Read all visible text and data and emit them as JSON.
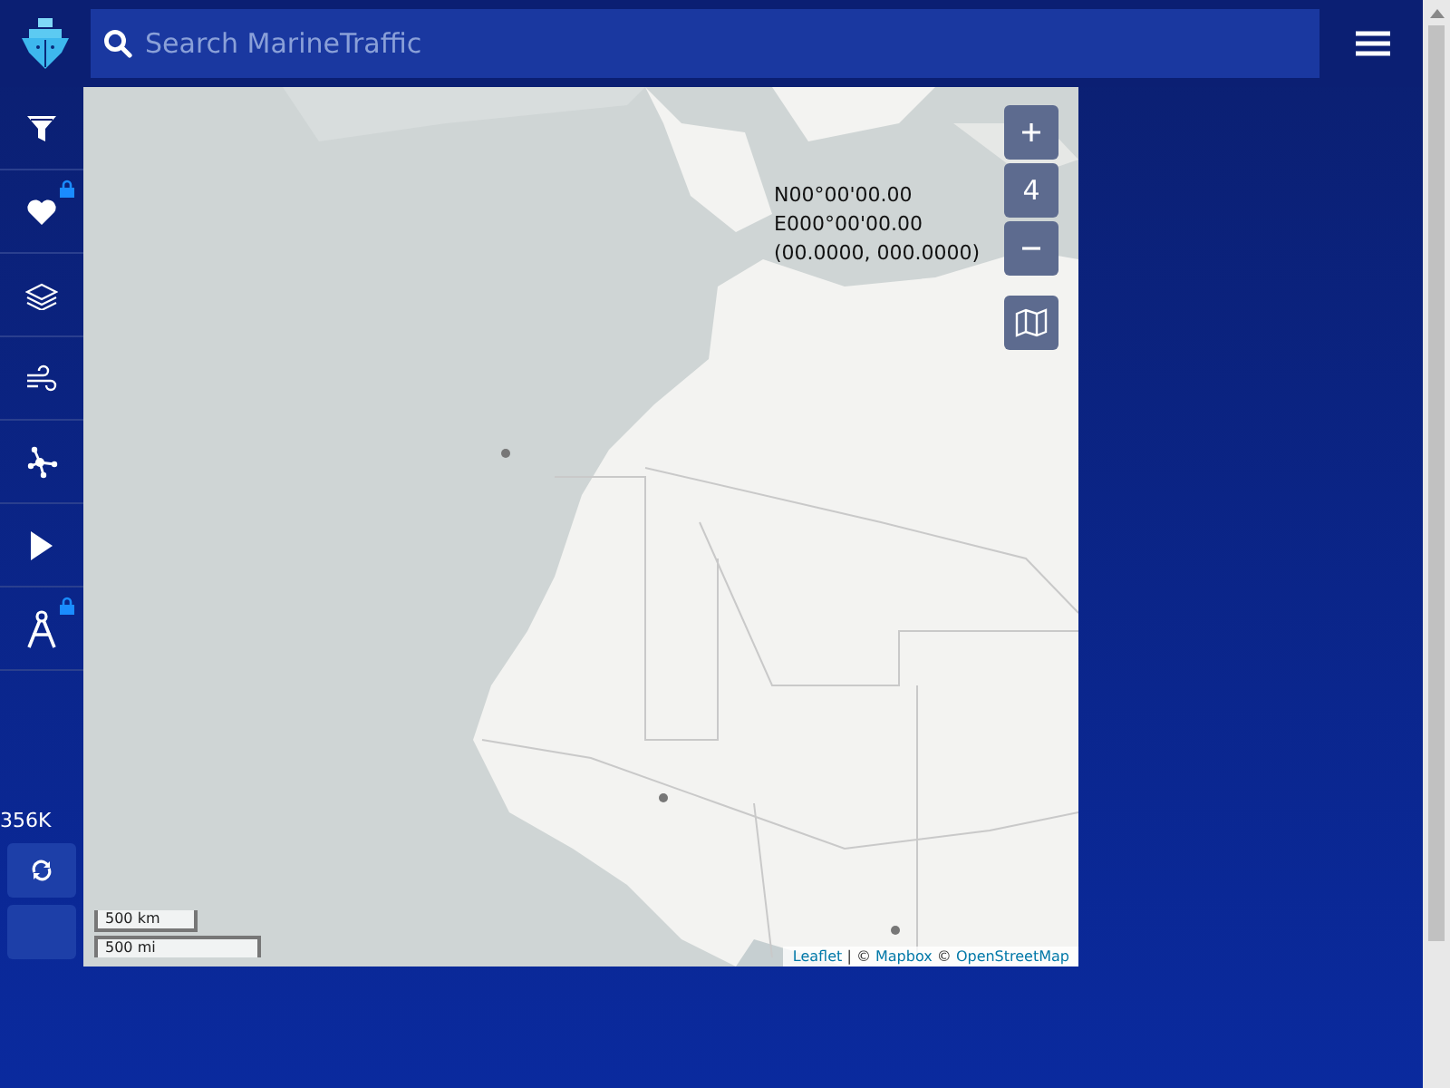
{
  "header": {
    "search": {
      "placeholder": "Search MarineTraffic"
    }
  },
  "sidebar": {
    "items": [
      {
        "kind": "filter",
        "locked": false
      },
      {
        "kind": "heart",
        "locked": true
      },
      {
        "kind": "layers",
        "locked": false
      },
      {
        "kind": "wind",
        "locked": false
      },
      {
        "kind": "network",
        "locked": false
      },
      {
        "kind": "play",
        "locked": false
      },
      {
        "kind": "compass",
        "locked": true
      }
    ],
    "count": "356K"
  },
  "map": {
    "coordinates": [
      "N00°00'00.00",
      "E000°00'00.00",
      "(00.0000, 000.0000)"
    ],
    "zoom_level": "4",
    "scale": [
      "500 km",
      "500 mi"
    ],
    "attribution": [
      {
        "kind": "link",
        "text": "Leaflet"
      },
      {
        "kind": "text",
        "text": "| ©"
      },
      {
        "kind": "link",
        "text": "Mapbox"
      },
      {
        "kind": "text",
        "text": "©"
      },
      {
        "kind": "link",
        "text": "OpenStreetMap"
      }
    ]
  }
}
